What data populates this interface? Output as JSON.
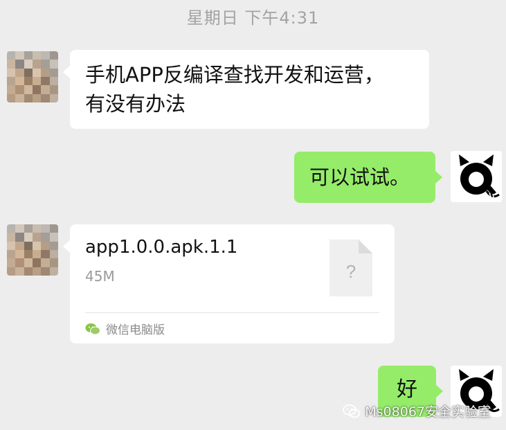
{
  "chat": {
    "timestamp": "星期日 下午4:31",
    "messages": [
      {
        "sender": "other",
        "type": "text",
        "text": "手机APP反编译查找开发和运营，\n有没有办法"
      },
      {
        "sender": "self",
        "type": "text",
        "text": "可以试试。"
      },
      {
        "sender": "other",
        "type": "file",
        "file_name": "app1.0.0.apk.1.1",
        "file_size": "45M",
        "file_icon": "?",
        "source": "微信电脑版"
      },
      {
        "sender": "self",
        "type": "text",
        "text": "好"
      }
    ]
  },
  "watermark": {
    "text": "Ms08067安全实验室",
    "icon": "wechat-icon"
  },
  "colors": {
    "background": "#ededed",
    "bubble_self": "#95ec69",
    "bubble_other": "#ffffff",
    "timestamp": "#a3a3a3"
  }
}
